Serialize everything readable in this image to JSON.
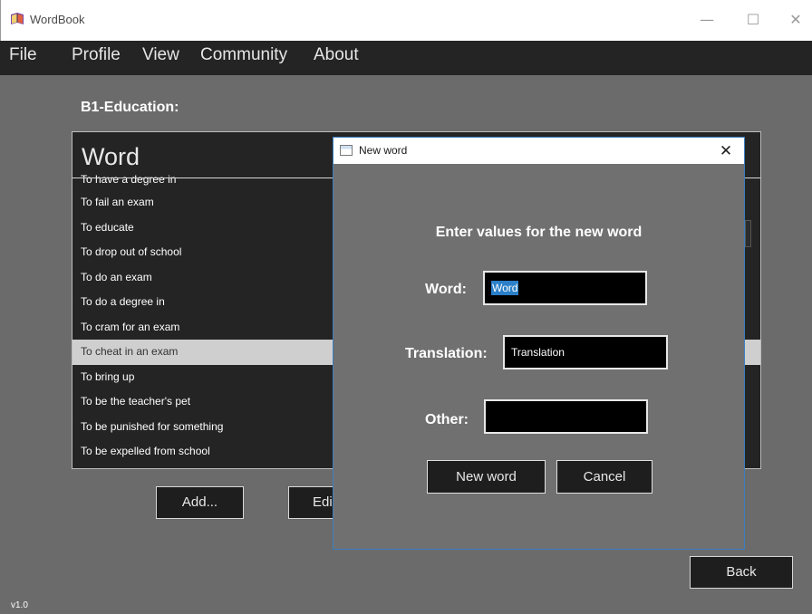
{
  "window": {
    "title": "WordBook",
    "minimize_glyph": "—",
    "maximize_glyph": "☐",
    "close_glyph": "✕"
  },
  "menu": {
    "items": [
      "File",
      "Profile",
      "View",
      "Community",
      "About"
    ]
  },
  "category": {
    "title": "B1-Education:"
  },
  "table": {
    "column_header": "Word",
    "rows": [
      "To have a degree in",
      "To fail an exam",
      "To educate",
      "To drop out of school",
      "To do an exam",
      "To do a degree in",
      "To cram for an exam",
      "To cheat in an exam",
      "To bring up",
      "To be the teacher's pet",
      "To be punished for something",
      "To be expelled from school"
    ],
    "selected_row": "To cheat in an exam"
  },
  "buttons": {
    "add": "Add...",
    "edit_visible": "Edi",
    "back": "Back"
  },
  "version": "v1.0",
  "dialog": {
    "title": "New word",
    "close_glyph": "✕",
    "heading": "Enter values for the new word",
    "word_label": "Word:",
    "word_value": "Word",
    "translation_label": "Translation:",
    "translation_value": "Translation",
    "other_label": "Other:",
    "other_value": "",
    "new_word_button": "New word",
    "cancel_button": "Cancel"
  },
  "colors": {
    "background": "#6b6b6b",
    "panel": "#242424",
    "selection": "#cfcfcf",
    "dialog_border": "#3a7fc3",
    "text_selection": "#2a7fc8"
  },
  "icons": {
    "app": "book-icon",
    "dialog": "window-icon"
  }
}
